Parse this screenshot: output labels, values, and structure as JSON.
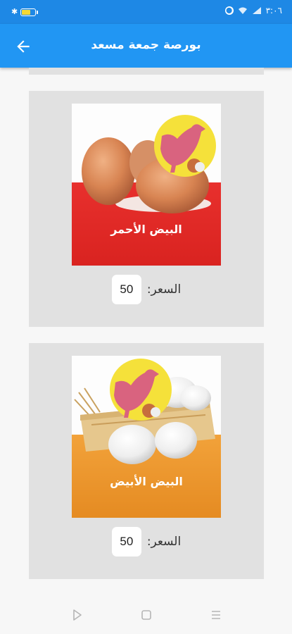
{
  "status_bar": {
    "time": "٣:٠٦",
    "bluetooth": "✱"
  },
  "app_bar": {
    "title": "بورصة جمعة مسعد",
    "back_icon": "arrow-back-icon"
  },
  "products": [
    {
      "name": "البيض الأحمر",
      "price_label": "السعر:",
      "price": "50",
      "band_color": "#e5312e"
    },
    {
      "name": "البيض الأبيض",
      "price_label": "السعر:",
      "price": "50",
      "band_color": "#ee9a2c"
    }
  ],
  "nav_bar": {
    "icons": [
      "back-triangle-icon",
      "home-square-icon",
      "recents-menu-icon"
    ]
  },
  "colors": {
    "primary": "#2196f3",
    "status_bar": "#1e88e5",
    "card_bg": "#e1e1e1",
    "logo_yellow": "#f5e13a",
    "logo_hen": "#d9637f"
  }
}
